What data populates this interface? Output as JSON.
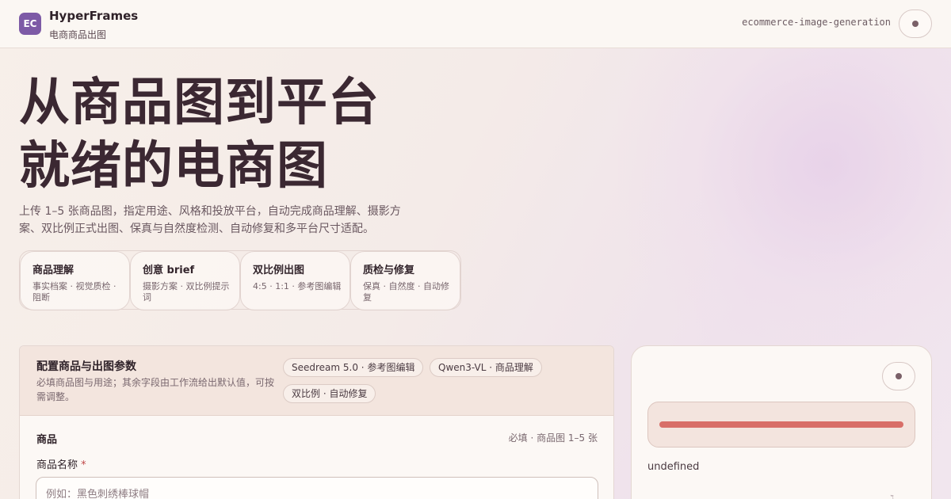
{
  "header": {
    "logo_text": "EC",
    "app_name": "HyperFrames",
    "subtitle": "电商商品出图",
    "slug": "ecommerce-image-generation"
  },
  "hero": {
    "title_line1": "从商品图到平台",
    "title_line2": "就绪的电商图",
    "desc_line1": "上传 1–5 张商品图，指定用途、风格和投放平台，自动完成商品理解、摄影方",
    "desc_line2": "案、双比例正式出图、保真与自然度检测、自动修复和多平台尺寸适配。"
  },
  "features": [
    {
      "title": "商品理解",
      "desc": "事实档案 · 视觉质检 · 阻断"
    },
    {
      "title": "创意 brief",
      "desc": "摄影方案 · 双比例提示词"
    },
    {
      "title": "双比例出图",
      "desc": "4:5 · 1:1 · 参考图编辑"
    },
    {
      "title": "质检与修复",
      "desc": "保真 · 自然度 · 自动修复"
    }
  ],
  "form": {
    "title": "配置商品与出图参数",
    "subtitle": "必填商品图与用途；其余字段由工作流给出默认值，可按需调整。",
    "chips": [
      "Seedream 5.0 · 参考图编辑",
      "Qwen3-VL · 商品理解",
      "双比例 · 自动修复"
    ],
    "section_title": "商品",
    "section_meta": "必填 · 商品图 1–5 张",
    "name_label": "商品名称",
    "required_mark": "*",
    "name_value": "",
    "name_placeholder": "例如：黑色刺绣棒球帽"
  },
  "side": {
    "progress": 1.0,
    "status_text": "undefined",
    "corner_glyph": "ℷ"
  },
  "colors": {
    "accent_logo": "#7d5aa6",
    "progress_fill": "#d86e68"
  }
}
